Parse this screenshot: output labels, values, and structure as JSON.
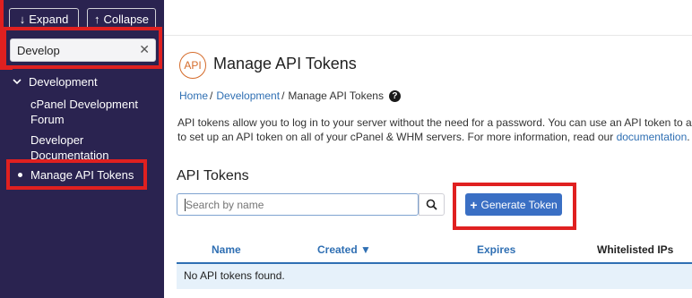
{
  "sidebar": {
    "expand_label": "Expand",
    "collapse_label": "Collapse",
    "search_value": "Develop",
    "group_label": "Development",
    "items": [
      {
        "label": "cPanel Development Forum"
      },
      {
        "label": "Developer Documentation"
      },
      {
        "label": "Manage API Tokens"
      }
    ]
  },
  "header": {
    "logo_text": "API",
    "title": "Manage API Tokens"
  },
  "breadcrumb": {
    "home": "Home",
    "development": "Development",
    "current": "Manage API Tokens",
    "separator": "/"
  },
  "description": {
    "line1": "API tokens allow you to log in to your server without the need for a password. You can use an API token to authenticate",
    "line2_prefix": "to set up an API token on all of your cPanel & WHM servers. For more information, read our ",
    "link": "documentation",
    "line2_suffix": "."
  },
  "tokens": {
    "section_title": "API Tokens",
    "search_placeholder": "Search by name",
    "generate_label": "Generate Token",
    "columns": [
      "Name",
      "Created ▼",
      "Expires",
      "Whitelisted IPs"
    ],
    "empty_message": "No API tokens found."
  },
  "colors": {
    "sidebar_bg": "#2a2350",
    "highlight": "#e02020",
    "primary_button": "#3a6fc4",
    "link": "#2f6fb3"
  },
  "icons": [
    "arrow-down-icon",
    "arrow-up-icon",
    "close-icon",
    "chevron-down-icon",
    "help-icon",
    "search-icon",
    "plus-icon"
  ]
}
